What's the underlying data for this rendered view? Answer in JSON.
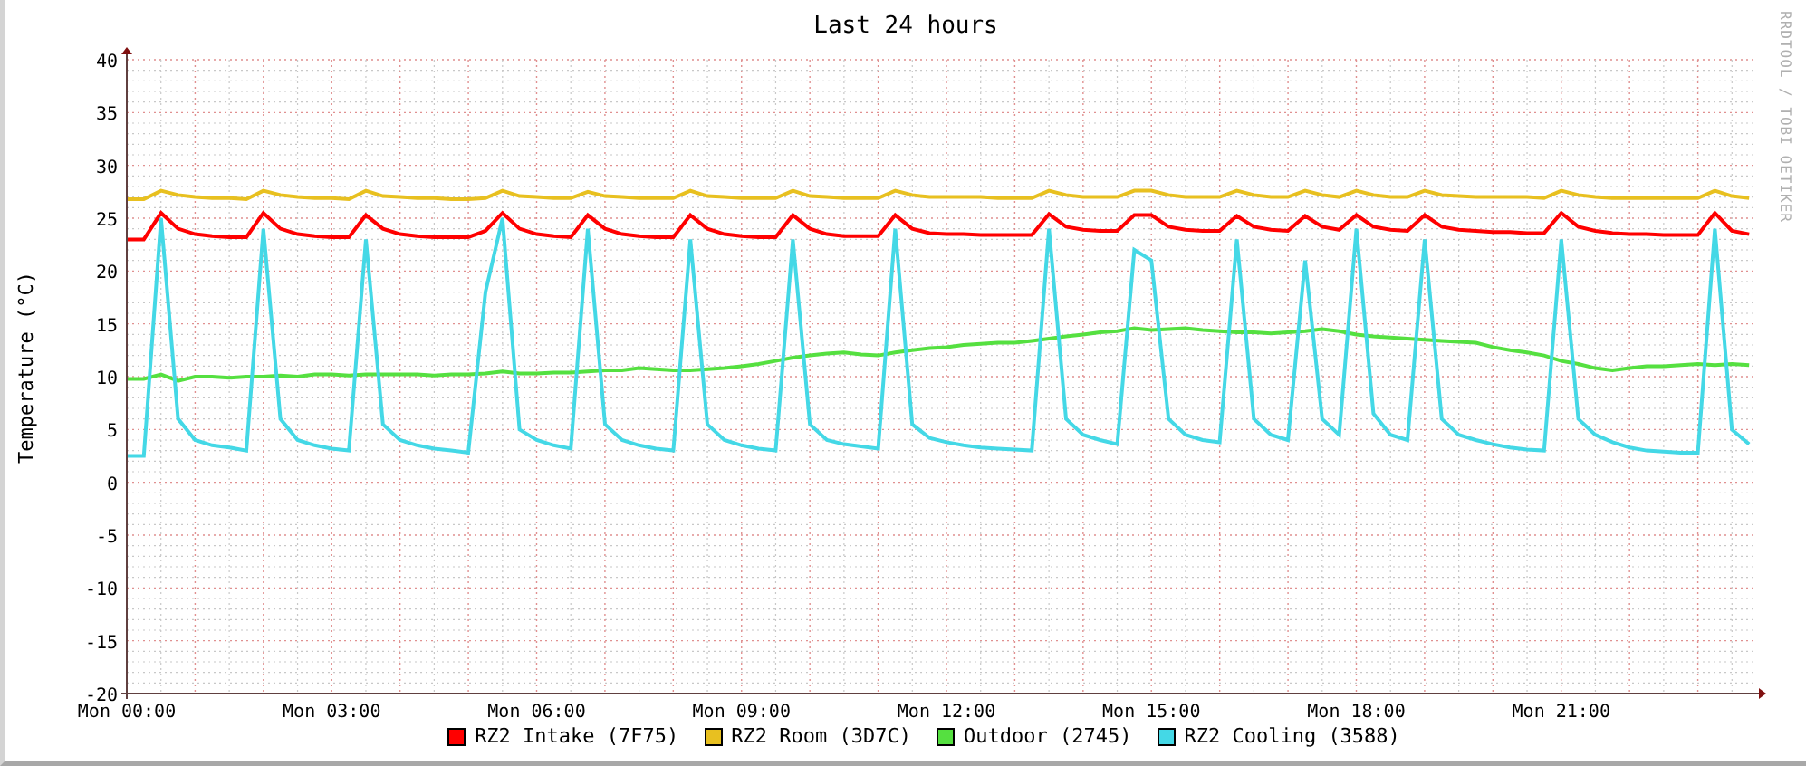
{
  "chart": {
    "credit": "RRDTOOL / TOBI OETIKER",
    "chart_data": {
      "type": "line",
      "title": "Last 24 hours",
      "ylabel": "Temperature (°C)",
      "categories": [
        "Mon 00:00",
        null,
        null,
        null,
        null,
        null,
        null,
        null,
        null,
        null,
        null,
        null,
        "Mon 03:00",
        null,
        null,
        null,
        null,
        null,
        null,
        null,
        null,
        null,
        null,
        null,
        "Mon 06:00",
        null,
        null,
        null,
        null,
        null,
        null,
        null,
        null,
        null,
        null,
        null,
        "Mon 09:00",
        null,
        null,
        null,
        null,
        null,
        null,
        null,
        null,
        null,
        null,
        null,
        "Mon 12:00",
        null,
        null,
        null,
        null,
        null,
        null,
        null,
        null,
        null,
        null,
        null,
        "Mon 15:00",
        null,
        null,
        null,
        null,
        null,
        null,
        null,
        null,
        null,
        null,
        null,
        "Mon 18:00",
        null,
        null,
        null,
        null,
        null,
        null,
        null,
        null,
        null,
        null,
        null,
        "Mon 21:00",
        null,
        null,
        null,
        null,
        null,
        null,
        null,
        null,
        null,
        null,
        null
      ],
      "series": [
        {
          "name": "RZ2 Intake (7F75)",
          "color": "#ff0000",
          "values": [
            23,
            23,
            25.5,
            24,
            23.5,
            23.3,
            23.2,
            23.2,
            25.5,
            24,
            23.5,
            23.3,
            23.2,
            23.2,
            25.3,
            24,
            23.5,
            23.3,
            23.2,
            23.2,
            23.2,
            23.8,
            25.5,
            24,
            23.5,
            23.3,
            23.2,
            25.3,
            24,
            23.5,
            23.3,
            23.2,
            23.2,
            25.3,
            24,
            23.5,
            23.3,
            23.2,
            23.2,
            25.3,
            24,
            23.5,
            23.3,
            23.3,
            23.3,
            25.3,
            24,
            23.6,
            23.5,
            23.5,
            23.4,
            23.4,
            23.4,
            23.4,
            25.4,
            24.2,
            23.9,
            23.8,
            23.8,
            25.3,
            25.3,
            24.2,
            23.9,
            23.8,
            23.8,
            25.2,
            24.2,
            23.9,
            23.8,
            25.2,
            24.2,
            23.9,
            25.3,
            24.2,
            23.9,
            23.8,
            25.3,
            24.2,
            23.9,
            23.8,
            23.7,
            23.7,
            23.6,
            23.6,
            25.5,
            24.2,
            23.8,
            23.6,
            23.5,
            23.5,
            23.4,
            23.4,
            23.4,
            25.5,
            23.8,
            23.5
          ]
        },
        {
          "name": "RZ2 Room (3D7C)",
          "color": "#e8c020",
          "values": [
            26.8,
            26.8,
            27.6,
            27.2,
            27,
            26.9,
            26.9,
            26.8,
            27.6,
            27.2,
            27,
            26.9,
            26.9,
            26.8,
            27.6,
            27.1,
            27,
            26.9,
            26.9,
            26.8,
            26.8,
            26.9,
            27.6,
            27.1,
            27,
            26.9,
            26.9,
            27.5,
            27.1,
            27,
            26.9,
            26.9,
            26.9,
            27.6,
            27.1,
            27,
            26.9,
            26.9,
            26.9,
            27.6,
            27.1,
            27,
            26.9,
            26.9,
            26.9,
            27.6,
            27.2,
            27,
            27,
            27,
            27,
            26.9,
            26.9,
            26.9,
            27.6,
            27.2,
            27,
            27,
            27,
            27.6,
            27.6,
            27.2,
            27,
            27,
            27,
            27.6,
            27.2,
            27,
            27,
            27.6,
            27.2,
            27,
            27.6,
            27.2,
            27,
            27,
            27.6,
            27.2,
            27.1,
            27,
            27,
            27,
            27,
            26.9,
            27.6,
            27.2,
            27,
            26.9,
            26.9,
            26.9,
            26.9,
            26.9,
            26.9,
            27.6,
            27.1,
            26.9
          ]
        },
        {
          "name": "Outdoor (2745)",
          "color": "#55e040",
          "values": [
            9.8,
            9.8,
            10.2,
            9.6,
            10,
            10,
            9.9,
            10,
            10,
            10.1,
            10,
            10.2,
            10.2,
            10.1,
            10.2,
            10.2,
            10.2,
            10.2,
            10.1,
            10.2,
            10.2,
            10.3,
            10.5,
            10.3,
            10.3,
            10.4,
            10.4,
            10.5,
            10.6,
            10.6,
            10.8,
            10.7,
            10.6,
            10.6,
            10.7,
            10.8,
            11,
            11.2,
            11.5,
            11.8,
            12,
            12.2,
            12.3,
            12.1,
            12,
            12.3,
            12.5,
            12.7,
            12.8,
            13,
            13.1,
            13.2,
            13.2,
            13.4,
            13.6,
            13.8,
            14,
            14.2,
            14.3,
            14.6,
            14.4,
            14.5,
            14.6,
            14.4,
            14.3,
            14.2,
            14.2,
            14.1,
            14.2,
            14.3,
            14.5,
            14.3,
            14,
            13.8,
            13.7,
            13.6,
            13.5,
            13.4,
            13.3,
            13.2,
            12.8,
            12.5,
            12.3,
            12,
            11.5,
            11.2,
            10.8,
            10.6,
            10.8,
            11,
            11,
            11.1,
            11.2,
            11.1,
            11.2,
            11.1
          ]
        },
        {
          "name": "RZ2 Cooling (3588)",
          "color": "#44d8e6",
          "values": [
            2.5,
            2.5,
            25,
            6,
            4,
            3.5,
            3.3,
            3,
            24,
            6,
            4,
            3.5,
            3.2,
            3,
            23,
            5.5,
            4,
            3.5,
            3.2,
            3,
            2.8,
            18,
            25,
            5,
            4,
            3.5,
            3.2,
            24,
            5.5,
            4,
            3.5,
            3.2,
            3,
            23,
            5.5,
            4,
            3.5,
            3.2,
            3,
            23,
            5.5,
            4,
            3.6,
            3.4,
            3.2,
            24,
            5.5,
            4.2,
            3.8,
            3.5,
            3.3,
            3.2,
            3.1,
            3,
            24,
            6,
            4.5,
            4,
            3.6,
            22,
            21,
            6,
            4.5,
            4,
            3.8,
            23,
            6,
            4.5,
            4,
            21,
            6,
            4.5,
            24,
            6.5,
            4.5,
            4,
            23,
            6,
            4.5,
            4,
            3.6,
            3.3,
            3.1,
            3,
            23,
            6,
            4.5,
            3.8,
            3.3,
            3,
            2.9,
            2.8,
            2.8,
            24,
            5,
            3.6
          ]
        }
      ],
      "ylim": [
        -20,
        40
      ],
      "grid": true,
      "yticks": [
        40,
        35,
        30,
        25,
        20,
        15,
        10,
        5,
        0,
        -5,
        -10,
        -15,
        -20
      ]
    }
  }
}
